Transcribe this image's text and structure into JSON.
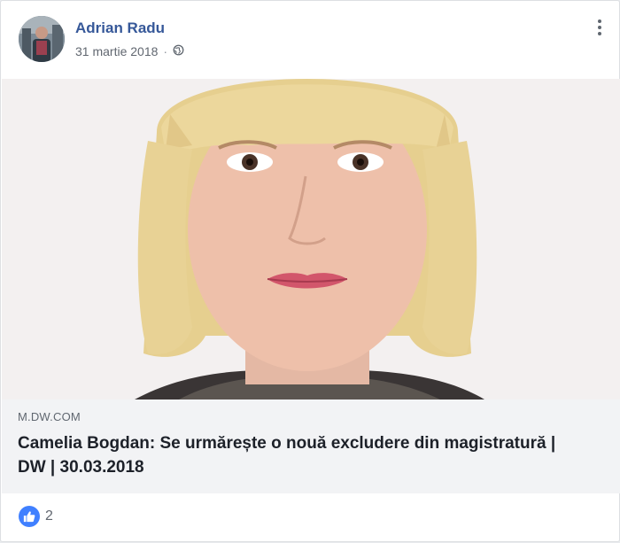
{
  "post": {
    "author": "Adrian Radu",
    "date": "31 martie 2018",
    "separator": "·",
    "privacy_icon": "globe-icon",
    "menu_icon": "more-options-icon"
  },
  "link_preview": {
    "domain": "M.DW.COM",
    "title": "Camelia Bogdan: Se urmărește o nouă excludere din magistratură | DW | 30.03.2018"
  },
  "reactions": {
    "icon": "like-icon",
    "count": "2"
  },
  "colors": {
    "author_link": "#365899",
    "like_blue": "#4080ff",
    "preview_bg": "#f2f3f5"
  }
}
